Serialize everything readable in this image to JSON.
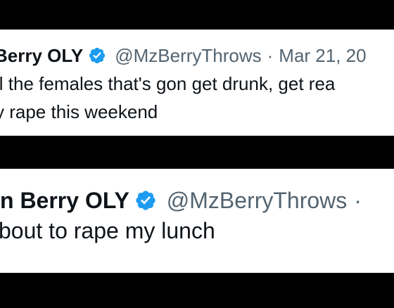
{
  "colors": {
    "background": "#000000",
    "card": "#ffffff",
    "text_primary": "#0f1419",
    "text_secondary": "#536471",
    "verified_badge": "#1d9bf0"
  },
  "tweets": [
    {
      "display_name": "Berry OLY",
      "verified_icon": "verified-badge-icon",
      "handle": "@MzBerryThrows",
      "separator": "·",
      "date": "Mar 21, 20",
      "text_lines": [
        "ll the females that's gon get drunk, get rea",
        "y rape this weekend"
      ]
    },
    {
      "display_name": "n Berry OLY",
      "verified_icon": "verified-badge-icon",
      "handle": "@MzBerryThrows",
      "separator": "·",
      "text_lines": [
        "bout to rape my lunch"
      ]
    }
  ]
}
